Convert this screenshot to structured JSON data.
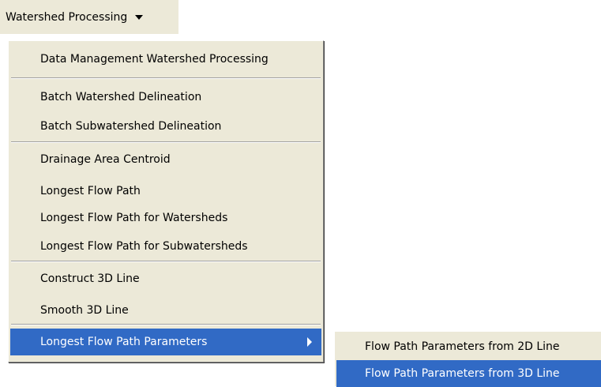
{
  "menubar": {
    "label": "Watershed Processing"
  },
  "menu": {
    "items": [
      "Data Management Watershed Processing",
      "Batch Watershed Delineation",
      "Batch Subwatershed Delineation",
      "Drainage Area Centroid",
      "Longest Flow Path",
      "Longest Flow Path for Watersheds",
      "Longest Flow Path for Subwatersheds",
      "Construct 3D Line",
      "Smooth 3D Line",
      "Longest Flow Path Parameters"
    ]
  },
  "submenu": {
    "items": [
      "Flow Path Parameters from 2D Line",
      "Flow Path Parameters from 3D Line"
    ]
  },
  "colors": {
    "highlight": "#316ac5",
    "menu_bg": "#ece9d8"
  }
}
